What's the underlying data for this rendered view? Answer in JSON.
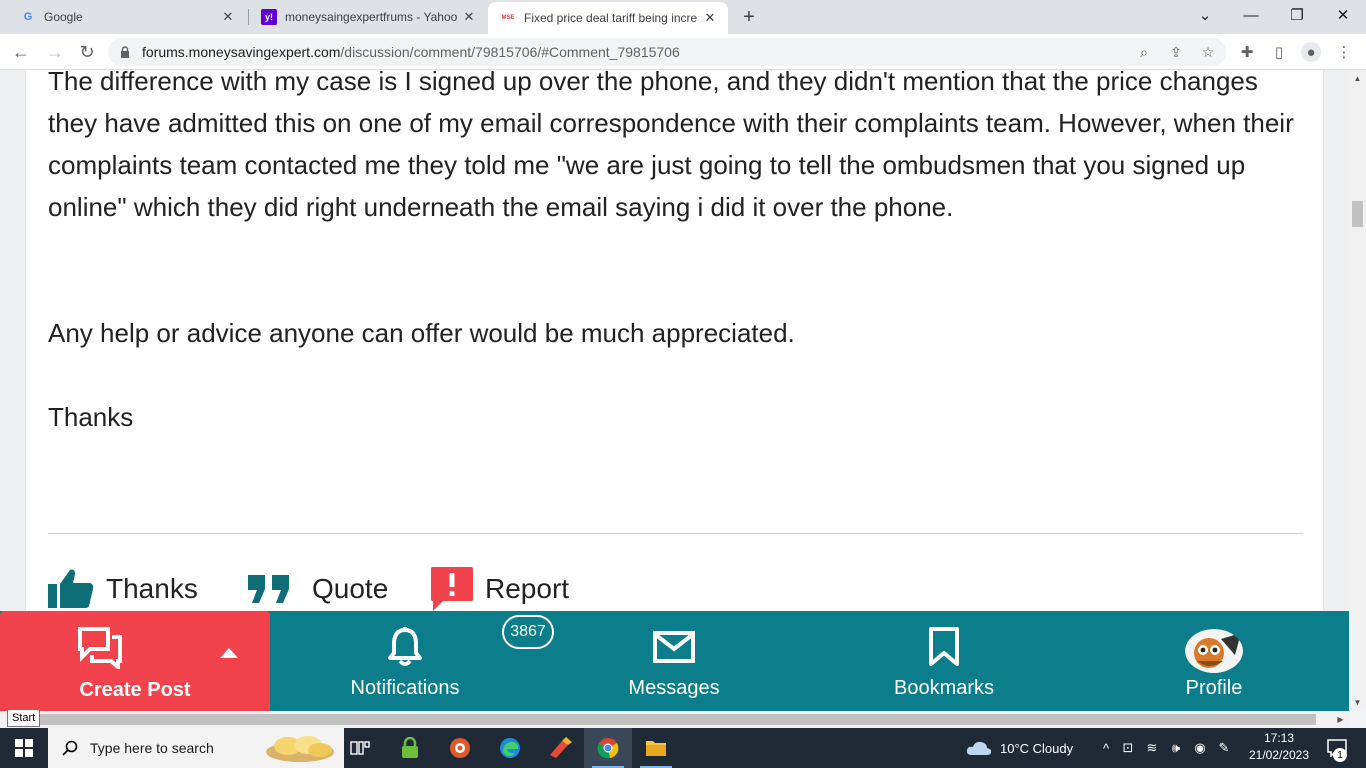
{
  "browser": {
    "tabs": [
      {
        "title": "Google",
        "favicon": "G"
      },
      {
        "title": "moneysaingexpertfrums - Yahoo",
        "favicon": "y!"
      },
      {
        "title": "Fixed price deal tariff being incre",
        "favicon": "MSE"
      }
    ],
    "url_host": "forums.moneysavingexpert.com",
    "url_path": "/discussion/comment/79815706/#Comment_79815706"
  },
  "post": {
    "paragraphs": [
      "The difference with my case is I signed up over the phone, and they didn't mention that the price changes they have admitted this on one of my email correspondence with their complaints team. However, when their complaints team contacted me they told me \"we are just going to tell the ombudsmen that you signed up online\" which they did right underneath the email saying i did it over the phone.",
      "Any help or advice anyone can offer would be much appreciated.",
      "Thanks"
    ],
    "actions": {
      "thanks": "Thanks",
      "quote": "Quote",
      "report": "Report"
    }
  },
  "bottom_nav": {
    "create_post": "Create Post",
    "notifications": "Notifications",
    "notifications_count": "3867",
    "messages": "Messages",
    "bookmarks": "Bookmarks",
    "profile": "Profile"
  },
  "tooltip": "Start",
  "taskbar": {
    "search_placeholder": "Type here to search",
    "weather": "10°C  Cloudy",
    "time": "17:13",
    "date": "21/02/2023",
    "notification_count": "1"
  },
  "colors": {
    "teal": "#0c7d8a",
    "red": "#f2424c",
    "icon_teal": "#0e6d76"
  }
}
